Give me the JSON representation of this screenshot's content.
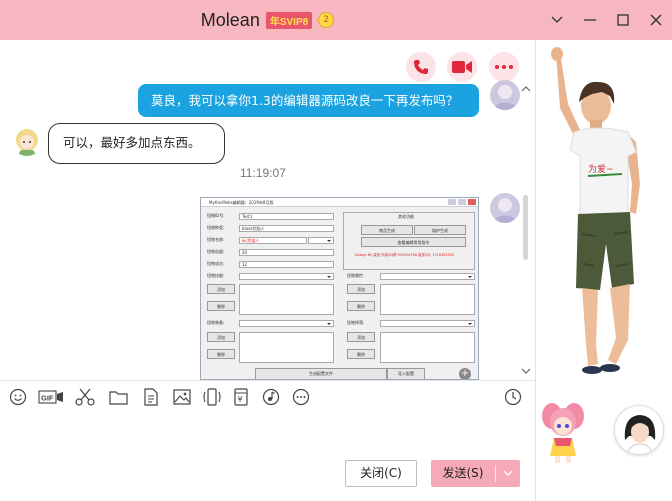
{
  "window": {
    "title": "Molean",
    "vip_badge": "年SVIP8",
    "crown": "2"
  },
  "chat": {
    "outgoing_message": "莫良，我可以拿你1.3的编辑器源码改良一下再发布吗？",
    "incoming_message": "可以，最好多加点东西。",
    "timestamp": "11:19:07"
  },
  "screenshot": {
    "window_title": "MythicMobs编辑器：2019年8月版",
    "fields": {
      "mob_id_label": "怪物ID号:",
      "mob_id_value": "Test1",
      "mob_type_label": "怪物种类:",
      "mob_type_value": "blaze烈焰人",
      "mob_name_label": "怪物名称:",
      "mob_name_value": "&c烈焰人",
      "mob_health_label": "怪物血量:",
      "mob_health_value": "20",
      "mob_damage_label": "怪物攻击:",
      "mob_damage_value": "12",
      "mob_skill_label": "怪物技能:",
      "mob_attr_label": "怪物属性:",
      "mob_equip_label": "怪物装备:",
      "mob_drop_label": "怪物掉落:"
    },
    "buttons": {
      "add": "添加",
      "delete": "删除",
      "generate": "物品生成",
      "smelt": "熔炉生成",
      "view_all": "查看编辑常用指令",
      "save": "生成配置文件",
      "import": "导入配置"
    },
    "other_label": "其他功能",
    "credit": "Design By 莫良 作者QQ群 932954706 莫良QQ: 1718302952"
  },
  "input": {
    "close_label": "关闭(C)",
    "send_label": "发送(S)"
  },
  "colors": {
    "titlebar": "#f7b7c1",
    "outgoing_bubble": "#1aa3e0",
    "send_button": "#f6aab8",
    "call_icon": "#e0273c"
  }
}
